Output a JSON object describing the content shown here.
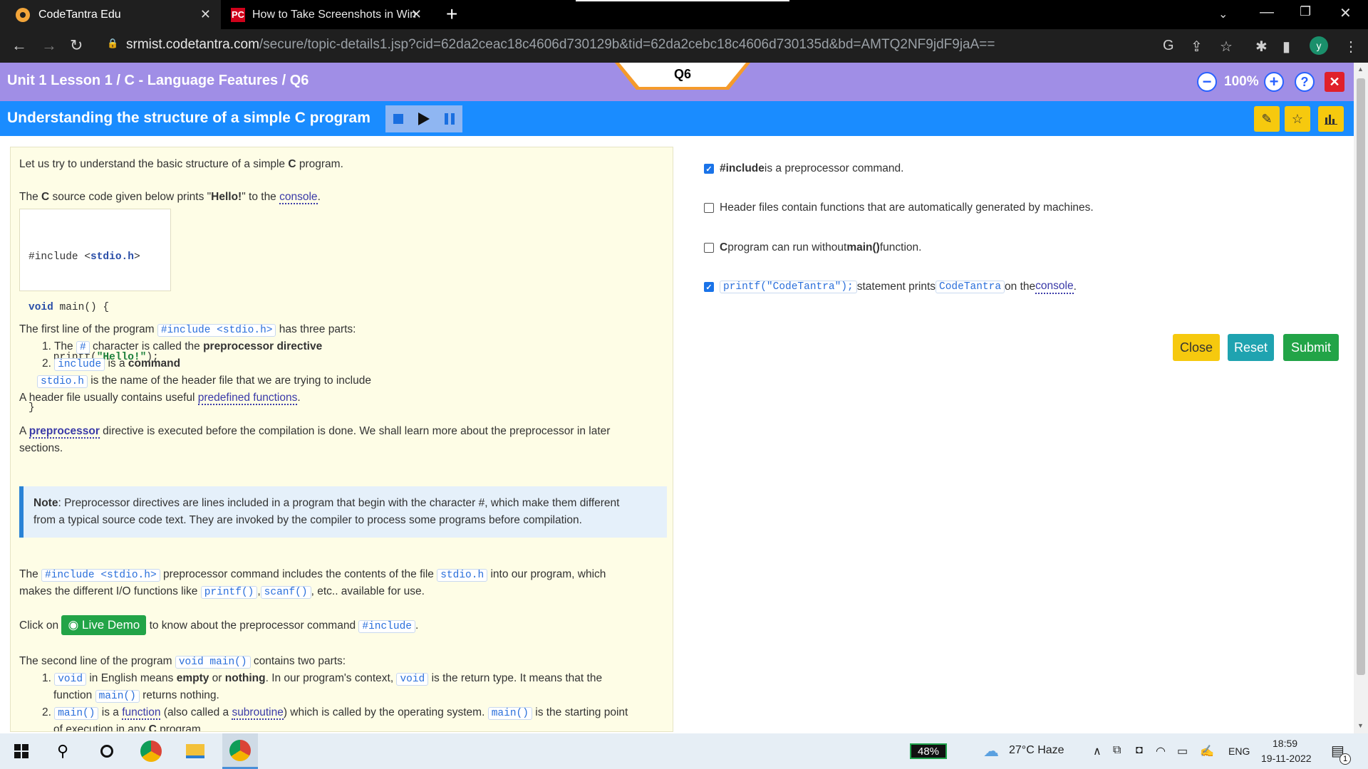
{
  "browser": {
    "tabs": [
      {
        "title": "CodeTantra Edu"
      },
      {
        "title": "How to Take Screenshots in Windo"
      }
    ],
    "url_host": "srmist.codetantra.com",
    "url_rest": "/secure/topic-details1.jsp?cid=62da2ceac18c4606d730129b&tid=62da2cebc18c4606d730135d&bd=AMTQ2NF9jdF9jaA==",
    "profile_initial": "y"
  },
  "header": {
    "breadcrumb": "Unit 1 Lesson 1 / C - Language Features / Q6",
    "question_tab": "Q6",
    "zoom": "100%",
    "lesson_title": "Understanding the structure of a simple C program"
  },
  "content": {
    "intro_a": "Let us try to understand the basic structure of a simple ",
    "intro_b": "C",
    "intro_c": " program.",
    "src_a": "The ",
    "src_b": "C",
    "src_c": " source code given below prints \"",
    "src_d": "Hello!",
    "src_e": "\" to the ",
    "src_link": "console",
    "src_f": ".",
    "code_l1_a": "#include <",
    "code_l1_b": "stdio.h",
    "code_l1_c": ">",
    "code_l2_kw": "void",
    "code_l2_rest": " main() {",
    "code_l3_a": "    printf(",
    "code_l3_b": "\"Hello!\"",
    "code_l3_c": ");",
    "code_l4": "}",
    "first_line_a": "The first line of the program ",
    "first_line_code": "#include <stdio.h>",
    "first_line_b": " has three parts:",
    "item1_num": "1. The ",
    "item1_code": "#",
    "item1_a": " character is called the ",
    "item1_b": "preprocessor directive",
    "item2_num": "2. ",
    "item2_code": "include",
    "item2_a": " is a ",
    "item2_b": "command",
    "item3_code": "stdio.h",
    "item3_a": " is the name of the header file that we are trying to include",
    "header_a": "A header file usually contains useful ",
    "header_link": "predefined functions",
    "header_b": ".",
    "pre_a": "A ",
    "pre_link": "preprocessor",
    "pre_b": " directive is executed before the compilation is done. We shall learn more about the preprocessor in later",
    "pre_c": "sections.",
    "note_label": "Note",
    "note_a": ": Preprocessor directives are lines included in a program that begin with the character #, which make them different",
    "note_b": "from a typical source code text. They are invoked by the compiler to process some programs before compilation.",
    "inc_a": "The ",
    "inc_code1": "#include <stdio.h>",
    "inc_b": " preprocessor command includes the contents of the file ",
    "inc_code2": "stdio.h",
    "inc_c": " into our program, which",
    "inc_d": "makes the different I/O functions like ",
    "inc_code3": "printf()",
    "inc_e": ",",
    "inc_code4": "scanf()",
    "inc_f": ", etc.. available for use.",
    "click_a": "Click on ",
    "live_demo": "Live Demo",
    "click_b": " to know about the preprocessor command ",
    "click_code": "#include",
    "click_c": ".",
    "second_a": "The second line of the program ",
    "second_code": "void main()",
    "second_b": " contains two parts:",
    "s1_num": "1. ",
    "s1_code": "void",
    "s1_a": " in English means ",
    "s1_b": "empty",
    "s1_c": " or ",
    "s1_d": "nothing",
    "s1_e": ". In our program's context, ",
    "s1_code2": "void",
    "s1_f": " is the return type. It means that the",
    "s1_g": "function ",
    "s1_code3": "main()",
    "s1_h": " returns nothing.",
    "s2_num": "2. ",
    "s2_code": "main()",
    "s2_a": " is a ",
    "s2_link1": "function",
    "s2_b": " (also called a ",
    "s2_link2": "subroutine",
    "s2_c": ") which is called by the operating system. ",
    "s2_code2": "main()",
    "s2_d": " is the starting point",
    "s2_e": "of execution in any ",
    "s2_f": "C",
    "s2_g": " program."
  },
  "options": {
    "o1_bold": "#include",
    "o1_rest": " is a preprocessor command.",
    "o1_checked": true,
    "o2_text": "Header files contain functions that are automatically generated by machines.",
    "o2_checked": false,
    "o3_bold": "C",
    "o3_a": " program can run without ",
    "o3_bold2": "main()",
    "o3_b": " function.",
    "o3_checked": false,
    "o4_code": "printf(\"CodeTantra\");",
    "o4_a": " statement prints ",
    "o4_code2": "CodeTantra",
    "o4_b": " on the ",
    "o4_link": "console",
    "o4_c": ".",
    "o4_checked": true
  },
  "actions": {
    "close": "Close",
    "reset": "Reset",
    "submit": "Submit"
  },
  "taskbar": {
    "battery": "48%",
    "weather": "27°C  Haze",
    "lang": "ENG",
    "time": "18:59",
    "date": "19-11-2022",
    "notif_count": "1"
  },
  "colors": {
    "purple_header": "#a08ee6",
    "blue_header": "#1a8cff",
    "close_btn": "#f6c90e",
    "reset_btn": "#1fa3b0",
    "submit_btn": "#22a447"
  }
}
